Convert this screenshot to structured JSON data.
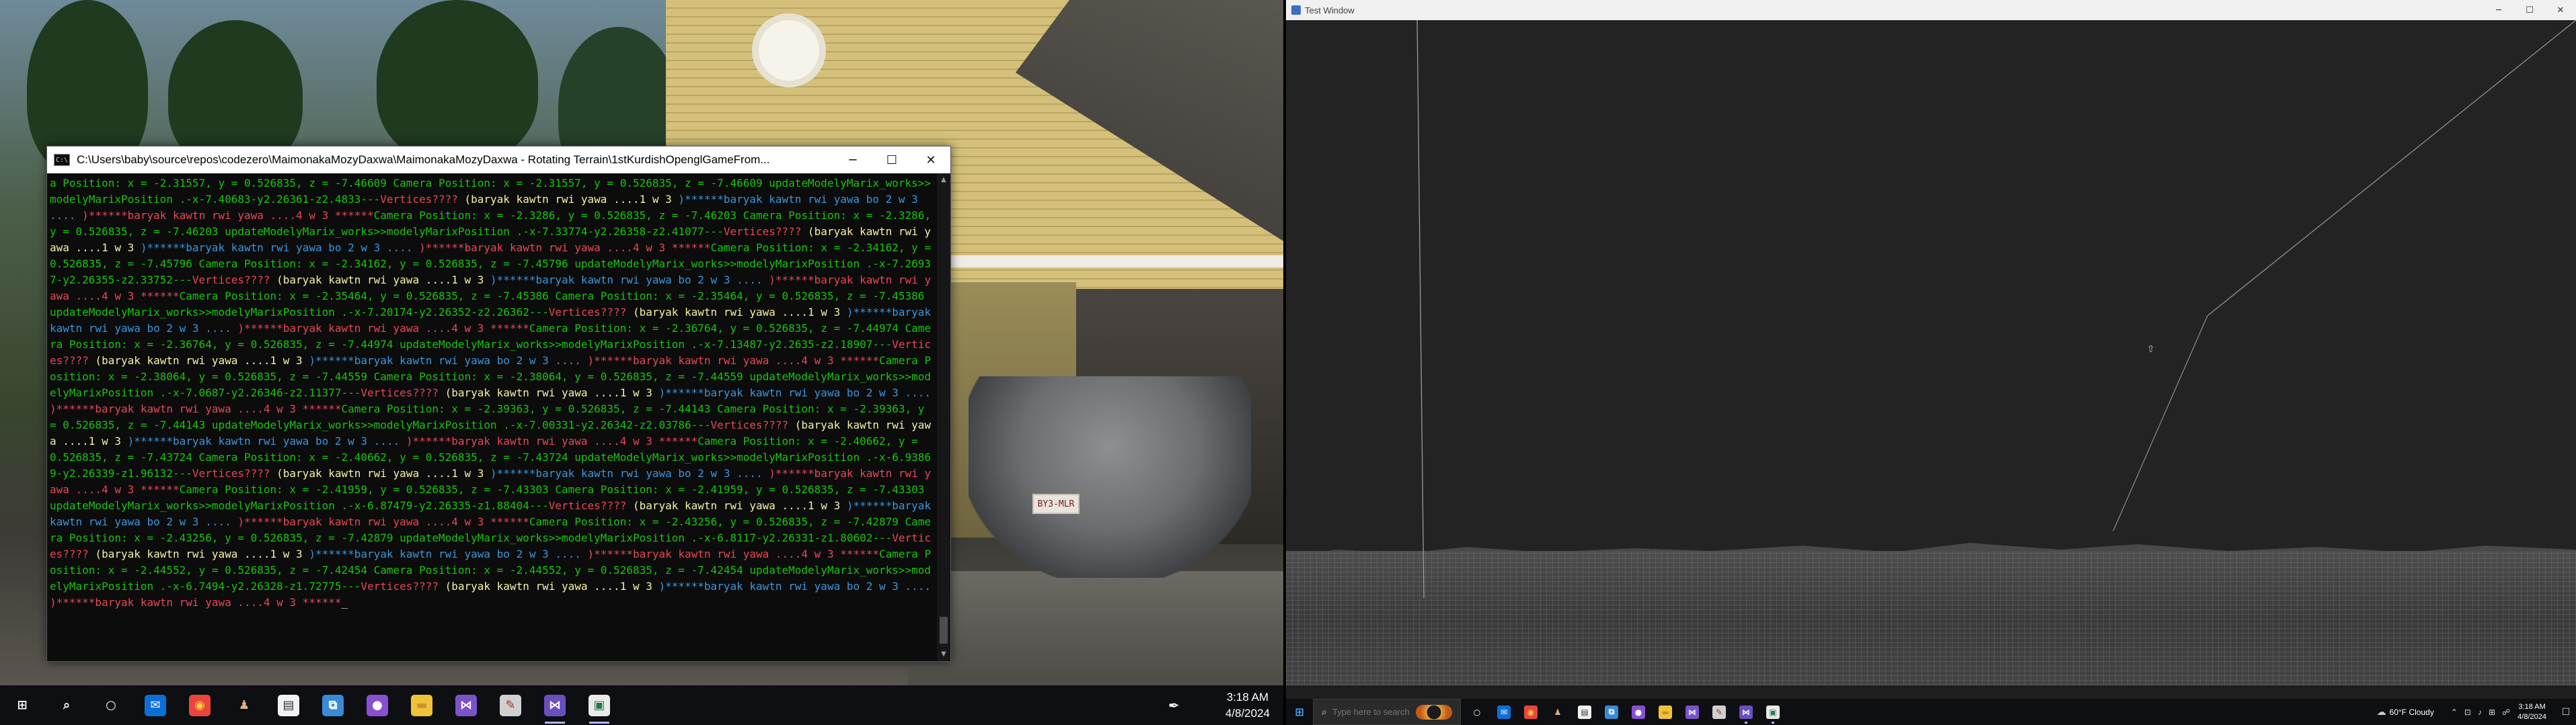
{
  "console": {
    "title": "C:\\Users\\baby\\source\\repos\\codezero\\MaimonakaMozyDaxwa\\MaimonakaMozyDaxwa - Rotating Terrain\\1stKurdishOpenglGameFrom...",
    "minimize": "─",
    "maximize": "☐",
    "close": "✕",
    "segments": [
      {
        "c": "green",
        "t": "a Position: x = -2.31557, y = 0.526835, z = -7.46609 Camera Position: x = -2.31557, y = 0.526835, z = -7.46609 updateModelyMarix_works>>modelyMarixPosition .-x-7.40683-y2.26361-z2.4833---"
      },
      {
        "c": "red",
        "t": "Vertices????"
      },
      {
        "c": "yellow",
        "t": " (baryak kawtn rwi yawa ....1 w 3 "
      },
      {
        "c": "cyan",
        "t": ")******baryak kawtn rwi yawa bo 2 w 3 .... "
      },
      {
        "c": "red",
        "t": ")******baryak kawtn rwi yawa ....4 w 3 ******"
      },
      {
        "c": "green",
        "t": "Camera Position: x = -2.3286, y = 0.526835, z = -7.46203 Camera Position: x = -2.3286, y = 0.526835, z = -7.46203 updateModelyMarix_works>>modelyMarixPosition .-x-7.33774-y2.26358-z2.41077---"
      },
      {
        "c": "red",
        "t": "Vertices????"
      },
      {
        "c": "yellow",
        "t": " (baryak kawtn rwi yawa ....1 w 3 "
      },
      {
        "c": "cyan",
        "t": ")******baryak kawtn rwi yawa bo 2 w 3 .... "
      },
      {
        "c": "red",
        "t": ")******baryak kawtn rwi yawa ....4 w 3 ******"
      },
      {
        "c": "green",
        "t": "Camera Position: x = -2.34162, y = 0.526835, z = -7.45796 Camera Position: x = -2.34162, y = 0.526835, z = -7.45796 updateModelyMarix_works>>modelyMarixPosition .-x-7.26937-y2.26355-z2.33752---"
      },
      {
        "c": "red",
        "t": "Vertices????"
      },
      {
        "c": "yellow",
        "t": " (baryak kawtn rwi yawa ....1 w 3 "
      },
      {
        "c": "cyan",
        "t": ")******baryak kawtn rwi yawa bo 2 w 3 .... "
      },
      {
        "c": "red",
        "t": ")******baryak kawtn rwi yawa ....4 w 3 ******"
      },
      {
        "c": "green",
        "t": "Camera Position: x = -2.35464, y = 0.526835, z = -7.45386 Camera Position: x = -2.35464, y = 0.526835, z = -7.45386 updateModelyMarix_works>>modelyMarixPosition .-x-7.20174-y2.26352-z2.26362---"
      },
      {
        "c": "red",
        "t": "Vertices????"
      },
      {
        "c": "yellow",
        "t": " (baryak kawtn rwi yawa ....1 w 3 "
      },
      {
        "c": "cyan",
        "t": ")******baryak kawtn rwi yawa bo 2 w 3 .... "
      },
      {
        "c": "red",
        "t": ")******baryak kawtn rwi yawa ....4 w 3 ******"
      },
      {
        "c": "green",
        "t": "Camera Position: x = -2.36764, y = 0.526835, z = -7.44974 Camera Position: x = -2.36764, y = 0.526835, z = -7.44974 updateModelyMarix_works>>modelyMarixPosition .-x-7.13487-y2.2635-z2.18907---"
      },
      {
        "c": "red",
        "t": "Vertices????"
      },
      {
        "c": "yellow",
        "t": " (baryak kawtn rwi yawa ....1 w 3 "
      },
      {
        "c": "cyan",
        "t": ")******baryak kawtn rwi yawa bo 2 w 3 .... "
      },
      {
        "c": "red",
        "t": ")******baryak kawtn rwi yawa ....4 w 3 ******"
      },
      {
        "c": "green",
        "t": "Camera Position: x = -2.38064, y = 0.526835, z = -7.44559 Camera Position: x = -2.38064, y = 0.526835, z = -7.44559 updateModelyMarix_works>>modelyMarixPosition .-x-7.0687-y2.26346-z2.11377---"
      },
      {
        "c": "red",
        "t": "Vertices????"
      },
      {
        "c": "yellow",
        "t": " (baryak kawtn rwi yawa ....1 w 3 "
      },
      {
        "c": "cyan",
        "t": ")******baryak kawtn rwi yawa bo 2 w 3 .... "
      },
      {
        "c": "red",
        "t": ")******baryak kawtn rwi yawa ....4 w 3 ******"
      },
      {
        "c": "green",
        "t": "Camera Position: x = -2.39363, y = 0.526835, z = -7.44143 Camera Position: x = -2.39363, y = 0.526835, z = -7.44143 updateModelyMarix_works>>modelyMarixPosition .-x-7.00331-y2.26342-z2.03786---"
      },
      {
        "c": "red",
        "t": "Vertices????"
      },
      {
        "c": "yellow",
        "t": " (baryak kawtn rwi yawa ....1 w 3 "
      },
      {
        "c": "cyan",
        "t": ")******baryak kawtn rwi yawa bo 2 w 3 .... "
      },
      {
        "c": "red",
        "t": ")******baryak kawtn rwi yawa ....4 w 3 ******"
      },
      {
        "c": "green",
        "t": "Camera Position: x = -2.40662, y = 0.526835, z = -7.43724 Camera Position: x = -2.40662, y = 0.526835, z = -7.43724 updateModelyMarix_works>>modelyMarixPosition .-x-6.93869-y2.26339-z1.96132---"
      },
      {
        "c": "red",
        "t": "Vertices????"
      },
      {
        "c": "yellow",
        "t": " (baryak kawtn rwi yawa ....1 w 3 "
      },
      {
        "c": "cyan",
        "t": ")******baryak kawtn rwi yawa bo 2 w 3 .... "
      },
      {
        "c": "red",
        "t": ")******baryak kawtn rwi yawa ....4 w 3 ******"
      },
      {
        "c": "green",
        "t": "Camera Position: x = -2.41959, y = 0.526835, z = -7.43303 Camera Position: x = -2.41959, y = 0.526835, z = -7.43303 updateModelyMarix_works>>modelyMarixPosition .-x-6.87479-y2.26335-z1.88404---"
      },
      {
        "c": "red",
        "t": "Vertices????"
      },
      {
        "c": "yellow",
        "t": " (baryak kawtn rwi yawa ....1 w 3 "
      },
      {
        "c": "cyan",
        "t": ")******baryak kawtn rwi yawa bo 2 w 3 .... "
      },
      {
        "c": "red",
        "t": ")******baryak kawtn rwi yawa ....4 w 3 ******"
      },
      {
        "c": "green",
        "t": "Camera Position: x = -2.43256, y = 0.526835, z = -7.42879 Camera Position: x = -2.43256, y = 0.526835, z = -7.42879 updateModelyMarix_works>>modelyMarixPosition .-x-6.8117-y2.26331-z1.80602---"
      },
      {
        "c": "red",
        "t": "Vertices????"
      },
      {
        "c": "yellow",
        "t": " (baryak kawtn rwi yawa ....1 w 3 "
      },
      {
        "c": "cyan",
        "t": ")******baryak kawtn rwi yawa bo 2 w 3 .... "
      },
      {
        "c": "red",
        "t": ")******baryak kawtn rwi yawa ....4 w 3 ******"
      },
      {
        "c": "green",
        "t": "Camera Position: x = -2.44552, y = 0.526835, z = -7.42454 Camera Position: x = -2.44552, y = 0.526835, z = -7.42454 updateModelyMarix_works>>modelyMarixPosition .-x-6.7494-y2.26328-z1.72775---"
      },
      {
        "c": "red",
        "t": "Vertices????"
      },
      {
        "c": "yellow",
        "t": " (baryak kawtn rwi yawa ....1 w 3 "
      },
      {
        "c": "cyan",
        "t": ")******baryak kawtn rwi yawa bo 2 w 3 .... "
      },
      {
        "c": "red",
        "t": ")******baryak kawtn rwi yawa ....4 w 3 ******"
      },
      {
        "c": "white",
        "t": "_"
      }
    ]
  },
  "wallpaper": {
    "plate_text": "BY3-MLR"
  },
  "taskbar_left": {
    "icons": [
      {
        "name": "start-icon",
        "glyph": "⊞",
        "bg": "transparent",
        "color": "#ffffff"
      },
      {
        "name": "search-icon",
        "glyph": "⌕",
        "bg": "transparent",
        "color": "#ffffff"
      },
      {
        "name": "cortana-icon",
        "glyph": "○",
        "bg": "transparent",
        "color": "#ffffff"
      },
      {
        "name": "mail-icon",
        "glyph": "✉",
        "bg": "#0b6fd6",
        "color": "#ffffff"
      },
      {
        "name": "chrome-icon",
        "glyph": "◉",
        "bg": "#e8453c",
        "color": "#fbd13b"
      },
      {
        "name": "avatar-app-icon",
        "glyph": "♟",
        "bg": "transparent",
        "color": "#e0b080"
      },
      {
        "name": "notepad-icon",
        "glyph": "▤",
        "bg": "#f2f2f2",
        "color": "#333333"
      },
      {
        "name": "network-app-icon",
        "glyph": "⧉",
        "bg": "#3a8ad6",
        "color": "#ffffff"
      },
      {
        "name": "github-icon",
        "glyph": "●",
        "bg": "#8a4fd1",
        "color": "#ffffff"
      },
      {
        "name": "file-explorer-icon",
        "glyph": "▬",
        "bg": "#f0c23a",
        "color": "#c9922a"
      },
      {
        "name": "visual-studio-icon",
        "glyph": "⋈",
        "bg": "#7b53c9",
        "color": "#ffffff"
      },
      {
        "name": "paint-app-icon",
        "glyph": "✎",
        "bg": "#d0d0d0",
        "color": "#b03030"
      },
      {
        "name": "visual-studio-debug-icon",
        "glyph": "⋈",
        "bg": "#6a4fc0",
        "color": "#ffffff"
      },
      {
        "name": "console-app-icon",
        "glyph": "▣",
        "bg": "#eaeaea",
        "color": "#1f7a4a"
      }
    ],
    "active_indices": [
      12,
      13
    ],
    "pen_glyph": "✒",
    "time": "3:18 AM",
    "date": "4/8/2024"
  },
  "gl_window": {
    "title": "Test Window",
    "minimize": "─",
    "maximize": "☐",
    "close": "✕"
  },
  "taskbar_right": {
    "search_placeholder": "Type here to search",
    "icons": [
      {
        "name": "task-view-icon",
        "glyph": "○",
        "bg": "transparent",
        "color": "#ffffff"
      },
      {
        "name": "mail-icon",
        "glyph": "✉",
        "bg": "#0b6fd6",
        "color": "#ffffff"
      },
      {
        "name": "chrome-icon",
        "glyph": "◉",
        "bg": "#e8453c",
        "color": "#fbd13b"
      },
      {
        "name": "avatar-app-icon",
        "glyph": "♟",
        "bg": "transparent",
        "color": "#e0b080"
      },
      {
        "name": "notepad-icon",
        "glyph": "▤",
        "bg": "#f2f2f2",
        "color": "#333333"
      },
      {
        "name": "network-app-icon",
        "glyph": "⧉",
        "bg": "#3a8ad6",
        "color": "#ffffff"
      },
      {
        "name": "github-icon",
        "glyph": "●",
        "bg": "#8a4fd1",
        "color": "#ffffff"
      },
      {
        "name": "file-explorer-icon",
        "glyph": "▬",
        "bg": "#f0c23a",
        "color": "#c9922a"
      },
      {
        "name": "visual-studio-icon",
        "glyph": "⋈",
        "bg": "#7b53c9",
        "color": "#ffffff"
      },
      {
        "name": "paint-app-icon",
        "glyph": "✎",
        "bg": "#d0d0d0",
        "color": "#b03030"
      },
      {
        "name": "visual-studio-debug-icon",
        "glyph": "⋈",
        "bg": "#6a4fc0",
        "color": "#ffffff"
      },
      {
        "name": "console-app-icon",
        "glyph": "▣",
        "bg": "#eaeaea",
        "color": "#1f7a4a"
      }
    ],
    "active_indices": [
      10,
      11
    ],
    "weather": "60°F  Cloudy",
    "tray_glyphs": [
      "⌃",
      "⊡",
      "♪",
      "⊞",
      "☍"
    ],
    "time": "3:18 AM",
    "date": "4/8/2024",
    "notification_glyph": "☐"
  }
}
